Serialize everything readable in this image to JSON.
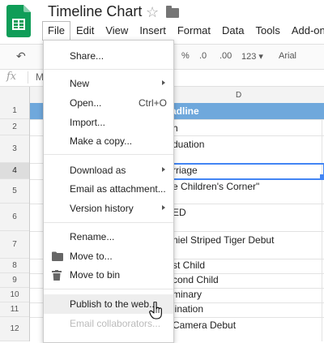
{
  "app": {
    "title": "Timeline Chart",
    "logo": "sheets-logo-icon",
    "brand_color": "#0f9d58"
  },
  "menubar": [
    "File",
    "Edit",
    "View",
    "Insert",
    "Format",
    "Data",
    "Tools",
    "Add-ons"
  ],
  "toolbar": {
    "percent": "%",
    "dec_decrease": ".0",
    "dec_increase": ".00",
    "more_formats": "123",
    "font": "Arial"
  },
  "formula_bar": {
    "fx": "fx",
    "partial": "M"
  },
  "grid": {
    "column_visible": "D",
    "header_cell": "adline",
    "header_color": "#6fa8dc",
    "selected_row": "4",
    "rows": [
      {
        "num": "1"
      },
      {
        "num": "2",
        "text": "h"
      },
      {
        "num": "3",
        "text": "duation"
      },
      {
        "num": "4",
        "text": "rriage"
      },
      {
        "num": "5",
        "text": "e Children's Corner\""
      },
      {
        "num": "6",
        "text": "ED"
      },
      {
        "num": "7",
        "text": "niel Striped Tiger Debut"
      },
      {
        "num": "8",
        "text": "st Child"
      },
      {
        "num": "9",
        "text": "cond Child"
      },
      {
        "num": "10",
        "text": "minary"
      },
      {
        "num": "11",
        "text": "lination"
      },
      {
        "num": "12",
        "text": "Camera Debut"
      }
    ]
  },
  "file_menu": {
    "share": "Share...",
    "new": "New",
    "open": "Open...",
    "open_shortcut": "Ctrl+O",
    "import": "Import...",
    "make_copy": "Make a copy...",
    "download_as": "Download as",
    "email_attachment": "Email as attachment...",
    "version_history": "Version history",
    "rename": "Rename...",
    "move_to": "Move to...",
    "move_to_bin": "Move to bin",
    "publish": "Publish to the web...",
    "email_collaborators": "Email collaborators..."
  }
}
